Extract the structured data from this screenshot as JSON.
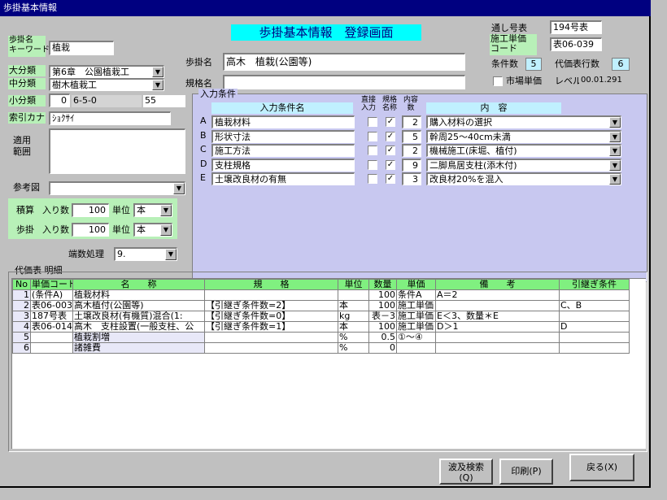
{
  "window": {
    "title": "歩掛基本情報"
  },
  "header": {
    "screen_title": "歩掛基本情報　登録画面"
  },
  "left": {
    "keyword_label": "歩掛名\nキーワード",
    "keyword_value": "植栽",
    "daibunrui_label": "大分類",
    "daibunrui_value": "第6章　公園植栽工",
    "chubunrui_label": "中分類",
    "chubunrui_value": "樹木植栽工",
    "shobunrui_label": "小分類",
    "shobunrui_value": "0",
    "shobunrui_code": "6-5-0",
    "shobunrui_num": "55",
    "kana_label": "索引カナ",
    "kana_value": "ｼｮｸｻｲ",
    "tekiyo_label": "適用\n範囲",
    "sanko_label": "参考図",
    "sekisan_label": "積算",
    "sekisan_iri_label": "入り数",
    "sekisan_iri_value": "100",
    "sekisan_tani_label": "単位",
    "sekisan_tani_value": "本",
    "bugake_label": "歩掛",
    "bugake_iri_label": "入り数",
    "bugake_iri_value": "100",
    "bugake_tani_label": "単位",
    "bugake_tani_value": "本",
    "hasu_label": "端数処理",
    "hasu_value": "9."
  },
  "center": {
    "bugakemei_label": "歩掛名",
    "bugakemei_value": "高木　植栽(公園等)",
    "kikakumei_label": "規格名",
    "kikakumei_value": ""
  },
  "right": {
    "toshi_label": "通し号表",
    "toshi_value": "194号表",
    "tanka_label": "施工単価\nコード",
    "tanka_value": "表06-039",
    "joken_label": "条件数",
    "joken_value": "5",
    "daika_label": "代価表行数",
    "daika_value": "6",
    "shijo_label": "市場単価",
    "level_label": "レベル",
    "level_value": "00.01.291"
  },
  "conditions": {
    "group_label": "入力条件",
    "hdr_name": "入力条件名",
    "hdr_direct": "直接\n入力",
    "hdr_kikaku": "規格\n名称",
    "hdr_count": "内容\n数",
    "hdr_content": "内　容",
    "rows": [
      {
        "letter": "A",
        "name": "植栽材料",
        "direct": "",
        "kikaku": "✓",
        "count": "2",
        "content": "購入材料の選択"
      },
      {
        "letter": "B",
        "name": "形状寸法",
        "direct": "",
        "kikaku": "✓",
        "count": "5",
        "content": "幹周25～40cm未満"
      },
      {
        "letter": "C",
        "name": "施工方法",
        "direct": "",
        "kikaku": "✓",
        "count": "2",
        "content": "機械施工(床堀、植付)"
      },
      {
        "letter": "D",
        "name": "支柱規格",
        "direct": "",
        "kikaku": "✓",
        "count": "9",
        "content": "二脚鳥居支柱(添木付)"
      },
      {
        "letter": "E",
        "name": "土壌改良材の有無",
        "direct": "",
        "kikaku": "✓",
        "count": "3",
        "content": "改良材20%を混入"
      }
    ]
  },
  "detail": {
    "group_label": "代価表 明細",
    "headers": [
      "No",
      "単価コード",
      "名　　称",
      "規　　格",
      "単位",
      "数量",
      "単価",
      "備　　考",
      "引継ぎ条件"
    ],
    "rows": [
      [
        "1",
        "(条件A)",
        "植栽材料",
        "",
        "",
        "100",
        "条件A",
        "A＝2",
        ""
      ],
      [
        "2",
        "表06-003",
        "高木植付(公園等)",
        "【引継ぎ条件数=2】",
        "本",
        "100",
        "施工単価",
        "",
        "C、B"
      ],
      [
        "3",
        "187号表",
        "土壌改良材(有機質)混合(1:",
        "【引継ぎ条件数=0】",
        "kg",
        "表－3",
        "施工単価",
        "E＜3、数量＊E",
        ""
      ],
      [
        "4",
        "表06-014",
        "高木　支柱設置(一般支柱、公",
        "【引継ぎ条件数=1】",
        "本",
        "100",
        "施工単価",
        "D＞1",
        "D"
      ],
      [
        "5",
        "",
        "植栽割増",
        "",
        "%",
        "0.5",
        "①～④",
        "",
        ""
      ],
      [
        "6",
        "",
        "諸雑費",
        "",
        "%",
        "0",
        "",
        "",
        ""
      ]
    ]
  },
  "buttons": {
    "hakyu": "波及検索\n(Q)",
    "print": "印刷(P)",
    "back": "戻る(X)"
  }
}
